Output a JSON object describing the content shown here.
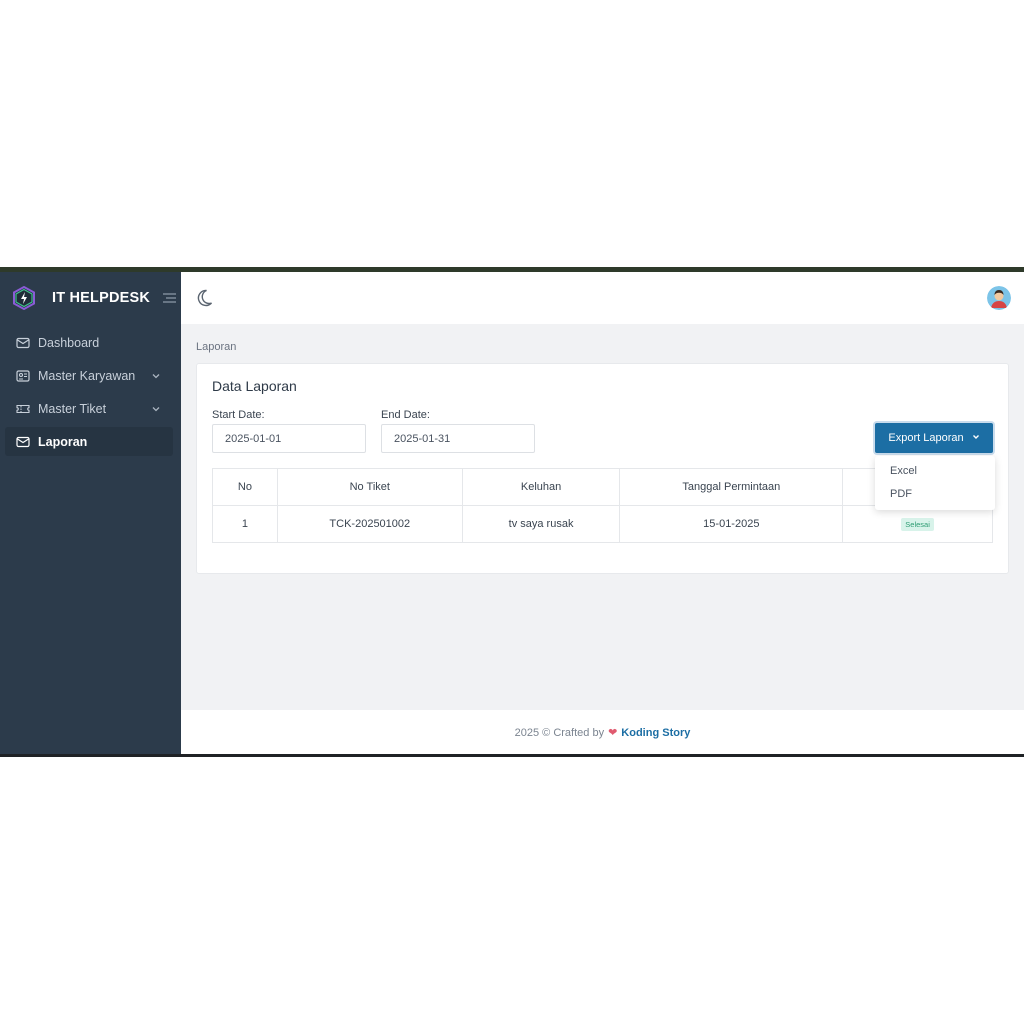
{
  "app": {
    "name": "IT HELPDESK"
  },
  "sidebar": {
    "items": [
      {
        "label": "Dashboard",
        "icon": "envelope-icon",
        "expandable": false,
        "active": false
      },
      {
        "label": "Master Karyawan",
        "icon": "id-card-icon",
        "expandable": true,
        "active": false
      },
      {
        "label": "Master Tiket",
        "icon": "ticket-icon",
        "expandable": true,
        "active": false
      },
      {
        "label": "Laporan",
        "icon": "envelope-open-icon",
        "expandable": false,
        "active": true
      }
    ]
  },
  "breadcrumb": "Laporan",
  "card": {
    "title": "Data Laporan",
    "start_label": "Start Date:",
    "start_value": "2025-01-01",
    "end_label": "End Date:",
    "end_value": "2025-01-31",
    "export_label": "Export Laporan",
    "export_options": [
      "Excel",
      "PDF"
    ]
  },
  "table": {
    "headers": [
      "No",
      "No Tiket",
      "Keluhan",
      "Tanggal Permintaan"
    ],
    "rows": [
      {
        "no": "1",
        "ticket": "TCK-202501002",
        "complaint": "tv saya rusak",
        "date": "15-01-2025",
        "status": "Selesai"
      }
    ]
  },
  "footer": {
    "text": "2025 © Crafted by",
    "brand": "Koding Story"
  },
  "colors": {
    "sidebar": "#2c3b4b",
    "primary": "#1c6ea4",
    "success_bg": "#d8f3ea",
    "success_text": "#2f9d74"
  }
}
